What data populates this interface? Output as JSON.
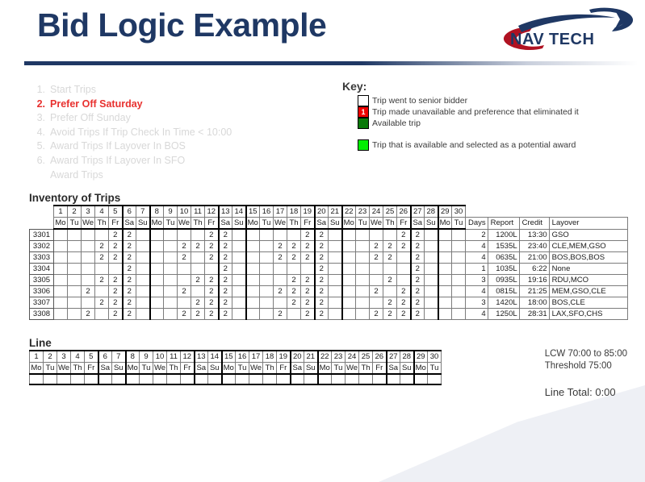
{
  "header": {
    "title": "Bid Logic Example",
    "logo_text": "NAVTECH"
  },
  "preferences": {
    "items": [
      {
        "num": "1.",
        "label": "Start Trips",
        "active": false
      },
      {
        "num": "2.",
        "label": "Prefer Off Saturday",
        "active": true
      },
      {
        "num": "3.",
        "label": "Prefer Off Sunday",
        "active": false
      },
      {
        "num": "4.",
        "label": "Avoid Trips If Trip Check In Time < 10:00",
        "active": false
      },
      {
        "num": "5.",
        "label": "Award Trips If Layover In BOS",
        "active": false
      },
      {
        "num": "6.",
        "label": "Award Trips If Layover In SFO",
        "active": false
      },
      {
        "num": "",
        "label": "Award Trips",
        "active": false
      }
    ]
  },
  "key": {
    "title": "Key:",
    "items": [
      {
        "color": "#ffffff",
        "glyph": "",
        "label": "Trip went to senior bidder"
      },
      {
        "color": "#ee0000",
        "glyph": "1",
        "label": "Trip made unavailable and preference that eliminated it"
      },
      {
        "color": "#0a7a0a",
        "glyph": "",
        "label": "Available trip"
      }
    ],
    "extra": {
      "color": "#00ee00",
      "glyph": "",
      "label": "Trip that is available and selected as a potential award"
    }
  },
  "inventory": {
    "caption": "Inventory of Trips",
    "day_numbers": [
      "1",
      "2",
      "3",
      "4",
      "5",
      "6",
      "7",
      "8",
      "9",
      "10",
      "11",
      "12",
      "13",
      "14",
      "15",
      "16",
      "17",
      "18",
      "19",
      "20",
      "21",
      "22",
      "23",
      "24",
      "25",
      "26",
      "27",
      "28",
      "29",
      "30"
    ],
    "day_names": [
      "Mo",
      "Tu",
      "We",
      "Th",
      "Fr",
      "Sa",
      "Su",
      "Mo",
      "Tu",
      "We",
      "Th",
      "Fr",
      "Sa",
      "Su",
      "Mo",
      "Tu",
      "We",
      "Th",
      "Fr",
      "Sa",
      "Su",
      "Mo",
      "Tu",
      "We",
      "Th",
      "Fr",
      "Sa",
      "Su",
      "Mo",
      "Tu"
    ],
    "weekend_index": [
      5,
      6,
      12,
      13,
      19,
      20,
      26,
      27
    ],
    "extra_headers": [
      "Days",
      "Report",
      "Credit",
      "Layover"
    ],
    "rows": [
      {
        "id": "3301",
        "cells": [
          "G",
          "G",
          "W",
          "G",
          "R",
          "R",
          "G",
          "G",
          "G",
          "G",
          "G",
          "R",
          "R",
          "G",
          "G",
          "G",
          "W",
          "G",
          "R",
          "R",
          "G",
          "G",
          "G",
          "W",
          "G",
          "R",
          "R",
          "G",
          "G",
          "G"
        ],
        "days": "2",
        "report": "1200L",
        "credit": "13:30",
        "layover": "GSO"
      },
      {
        "id": "3302",
        "cells": [
          "G",
          "G",
          "W",
          "R",
          "R",
          "R",
          "G",
          "G",
          "W",
          "R",
          "R",
          "R",
          "R",
          "G",
          "G",
          "G",
          "R",
          "R",
          "R",
          "R",
          "G",
          "G",
          "G",
          "R",
          "R",
          "R",
          "R",
          "G",
          "G",
          "G"
        ],
        "days": "4",
        "report": "1535L",
        "credit": "23:40",
        "layover": "CLE,MEM,GSO"
      },
      {
        "id": "3303",
        "cells": [
          "G",
          "G",
          "G",
          "R",
          "R",
          "R",
          "G",
          "G",
          "G",
          "R",
          "W",
          "R",
          "R",
          "W",
          "G",
          "G",
          "R",
          "R",
          "R",
          "R",
          "G",
          "G",
          "W",
          "R",
          "R",
          "W",
          "R",
          "G",
          "G",
          "G"
        ],
        "days": "4",
        "report": "0635L",
        "credit": "21:00",
        "layover": "BOS,BOS,BOS"
      },
      {
        "id": "3304",
        "cells": [
          "G",
          "W",
          "G",
          "G",
          "W",
          "R",
          "G",
          "G",
          "W",
          "G",
          "G",
          "W",
          "R",
          "G",
          "G",
          "W",
          "G",
          "W",
          "G",
          "R",
          "W",
          "G",
          "G",
          "W",
          "G",
          "G",
          "R",
          "G",
          "W",
          "G"
        ],
        "days": "1",
        "report": "1035L",
        "credit": "6:22",
        "layover": "None"
      },
      {
        "id": "3305",
        "cells": [
          "G",
          "G",
          "G",
          "R",
          "R",
          "R",
          "G",
          "G",
          "G",
          "G",
          "R",
          "R",
          "R",
          "G",
          "G",
          "W",
          "G",
          "R",
          "R",
          "R",
          "G",
          "G",
          "G",
          "G",
          "R",
          "W",
          "R",
          "G",
          "G",
          "G"
        ],
        "days": "3",
        "report": "0935L",
        "credit": "19:16",
        "layover": "RDU,MCO"
      },
      {
        "id": "3306",
        "cells": [
          "G",
          "G",
          "R",
          "W",
          "R",
          "R",
          "G",
          "G",
          "G",
          "R",
          "W",
          "R",
          "R",
          "G",
          "G",
          "W",
          "R",
          "R",
          "R",
          "R",
          "G",
          "W",
          "G",
          "R",
          "W",
          "R",
          "R",
          "G",
          "G",
          "G"
        ],
        "days": "4",
        "report": "0815L",
        "credit": "21:25",
        "layover": "MEM,GSO,CLE"
      },
      {
        "id": "3307",
        "cells": [
          "W",
          "G",
          "G",
          "R",
          "R",
          "R",
          "G",
          "G",
          "G",
          "W",
          "R",
          "R",
          "R",
          "G",
          "G",
          "G",
          "G",
          "R",
          "R",
          "R",
          "G",
          "G",
          "G",
          "G",
          "R",
          "R",
          "R",
          "G",
          "G",
          "G"
        ],
        "days": "3",
        "report": "1420L",
        "credit": "18:00",
        "layover": "BOS,CLE"
      },
      {
        "id": "3308",
        "cells": [
          "G",
          "G",
          "R",
          "W",
          "R",
          "R",
          "G",
          "G",
          "G",
          "R",
          "R",
          "R",
          "R",
          "G",
          "G",
          "G",
          "R",
          "W",
          "R",
          "R",
          "G",
          "G",
          "W",
          "R",
          "R",
          "R",
          "R",
          "G",
          "G",
          "G"
        ],
        "days": "4",
        "report": "1250L",
        "credit": "28:31",
        "layover": "LAX,SFO,CHS"
      }
    ],
    "red_glyph": "2"
  },
  "line": {
    "caption": "Line",
    "day_numbers": [
      "1",
      "2",
      "3",
      "4",
      "5",
      "6",
      "7",
      "8",
      "9",
      "10",
      "11",
      "12",
      "13",
      "14",
      "15",
      "16",
      "17",
      "18",
      "19",
      "20",
      "21",
      "22",
      "23",
      "24",
      "25",
      "26",
      "27",
      "28",
      "29",
      "30"
    ],
    "day_names": [
      "Mo",
      "Tu",
      "We",
      "Th",
      "Fr",
      "Sa",
      "Su",
      "Mo",
      "Tu",
      "We",
      "Th",
      "Fr",
      "Sa",
      "Su",
      "Mo",
      "Tu",
      "We",
      "Th",
      "Fr",
      "Sa",
      "Su",
      "Mo",
      "Tu",
      "We",
      "Th",
      "Fr",
      "Sa",
      "Su",
      "Mo",
      "Tu"
    ],
    "weekend_index": [
      5,
      6,
      12,
      13,
      19,
      20,
      26,
      27
    ]
  },
  "totals": {
    "lcw": "LCW 70:00 to 85:00",
    "threshold": "Threshold 75:00",
    "line_total": "Line Total: 0:00"
  }
}
